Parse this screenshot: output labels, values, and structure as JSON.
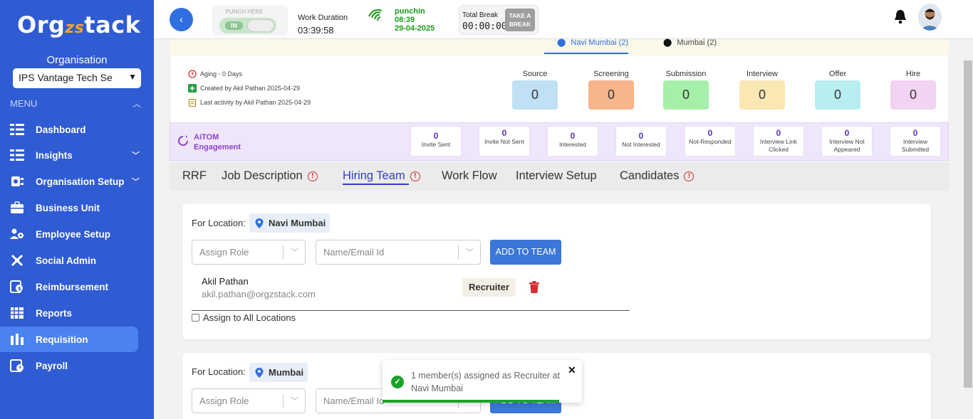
{
  "sidebar": {
    "logo": {
      "pre": "Org",
      "mid": "zs",
      "post": "tack"
    },
    "org_label": "Organisation",
    "org_select": "IPS Vantage Tech Se",
    "menu_label": "MENU",
    "items": [
      {
        "label": "Dashboard",
        "icon": "dashboard-icon"
      },
      {
        "label": "Insights",
        "icon": "insights-icon"
      },
      {
        "label": "Organisation Setup",
        "icon": "organisation-setup-icon"
      },
      {
        "label": "Business Unit",
        "icon": "briefcase-icon"
      },
      {
        "label": "Employee Setup",
        "icon": "employee-setup-icon"
      },
      {
        "label": "Social Admin",
        "icon": "social-admin-icon"
      },
      {
        "label": "Reimbursement",
        "icon": "reimbursement-icon"
      },
      {
        "label": "Reports",
        "icon": "reports-icon"
      },
      {
        "label": "Requisition",
        "icon": "requisition-icon"
      },
      {
        "label": "Payroll",
        "icon": "payroll-icon"
      }
    ]
  },
  "topbar": {
    "punch_label": "PUNCH HERE",
    "punch_state": "IN",
    "work_duration_label": "Work Duration",
    "work_duration": "03:39:58",
    "punchin_label": "punchin",
    "punchin_time": "08:39",
    "punchin_date": "29-04-2025",
    "total_break_label": "Total Break",
    "total_break": "00:00:00",
    "take_break": "TAKE A BREAK"
  },
  "location_tabs": [
    {
      "label": "Navi Mumbai (2)",
      "active": true
    },
    {
      "label": "Mumbai (2)",
      "active": false
    }
  ],
  "meta": {
    "aging": "Aging - 0 Days",
    "created": "Created by Akil Pathan 2025-04-29",
    "last_activity": "Last activity by Akil Pathan 2025-04-29"
  },
  "stages": [
    {
      "label": "Source",
      "value": "0",
      "color": "#bfe0f5"
    },
    {
      "label": "Screening",
      "value": "0",
      "color": "#f8b48a"
    },
    {
      "label": "Submission",
      "value": "0",
      "color": "#a6efa8"
    },
    {
      "label": "Interview",
      "value": "0",
      "color": "#fbe7b3"
    },
    {
      "label": "Offer",
      "value": "0",
      "color": "#b8eef0"
    },
    {
      "label": "Hire",
      "value": "0",
      "color": "#f2d3f2"
    }
  ],
  "aitom": {
    "title1": "AiTOM",
    "title2": "Engagement",
    "metrics": [
      {
        "value": "0",
        "label": "Invite Sent"
      },
      {
        "value": "0",
        "label": "Invite Not Sent"
      },
      {
        "value": "0",
        "label": "Interested"
      },
      {
        "value": "0",
        "label": "Not Interested"
      },
      {
        "value": "0",
        "label": "Not-Responded"
      },
      {
        "value": "0",
        "label": "Interview Link Clicked"
      },
      {
        "value": "0",
        "label": "Interview Not Appeared"
      },
      {
        "value": "0",
        "label": "Interview Submitted"
      }
    ]
  },
  "tabs": [
    {
      "label": "RRF",
      "warn": false
    },
    {
      "label": "Job Description",
      "warn": true
    },
    {
      "label": "Hiring Team",
      "warn": true,
      "active": true
    },
    {
      "label": "Work Flow",
      "warn": false
    },
    {
      "label": "Interview Setup",
      "warn": false
    },
    {
      "label": "Candidates",
      "warn": true
    }
  ],
  "hiring": {
    "for_location_label": "For Location:",
    "assign_role_placeholder": "Assign Role",
    "name_email_placeholder": "Name/Email Id",
    "add_button": "ADD TO TEAM",
    "assign_all_label": "Assign to All Locations",
    "locations": [
      {
        "name": "Navi Mumbai",
        "members": [
          {
            "name": "Akil Pathan",
            "email": "akil.pathan@orgzstack.com",
            "role": "Recruiter"
          }
        ]
      },
      {
        "name": "Mumbai",
        "members": []
      }
    ]
  },
  "toast": {
    "message": "1 member(s) assigned as Recruiter at Navi Mumbai",
    "close": "✕"
  },
  "colors": {
    "sidebar": "#2f5bd3",
    "active_nav": "#4a82f0",
    "accent": "#3a77d9",
    "success": "#1aa32a",
    "danger": "#d32f2f"
  }
}
